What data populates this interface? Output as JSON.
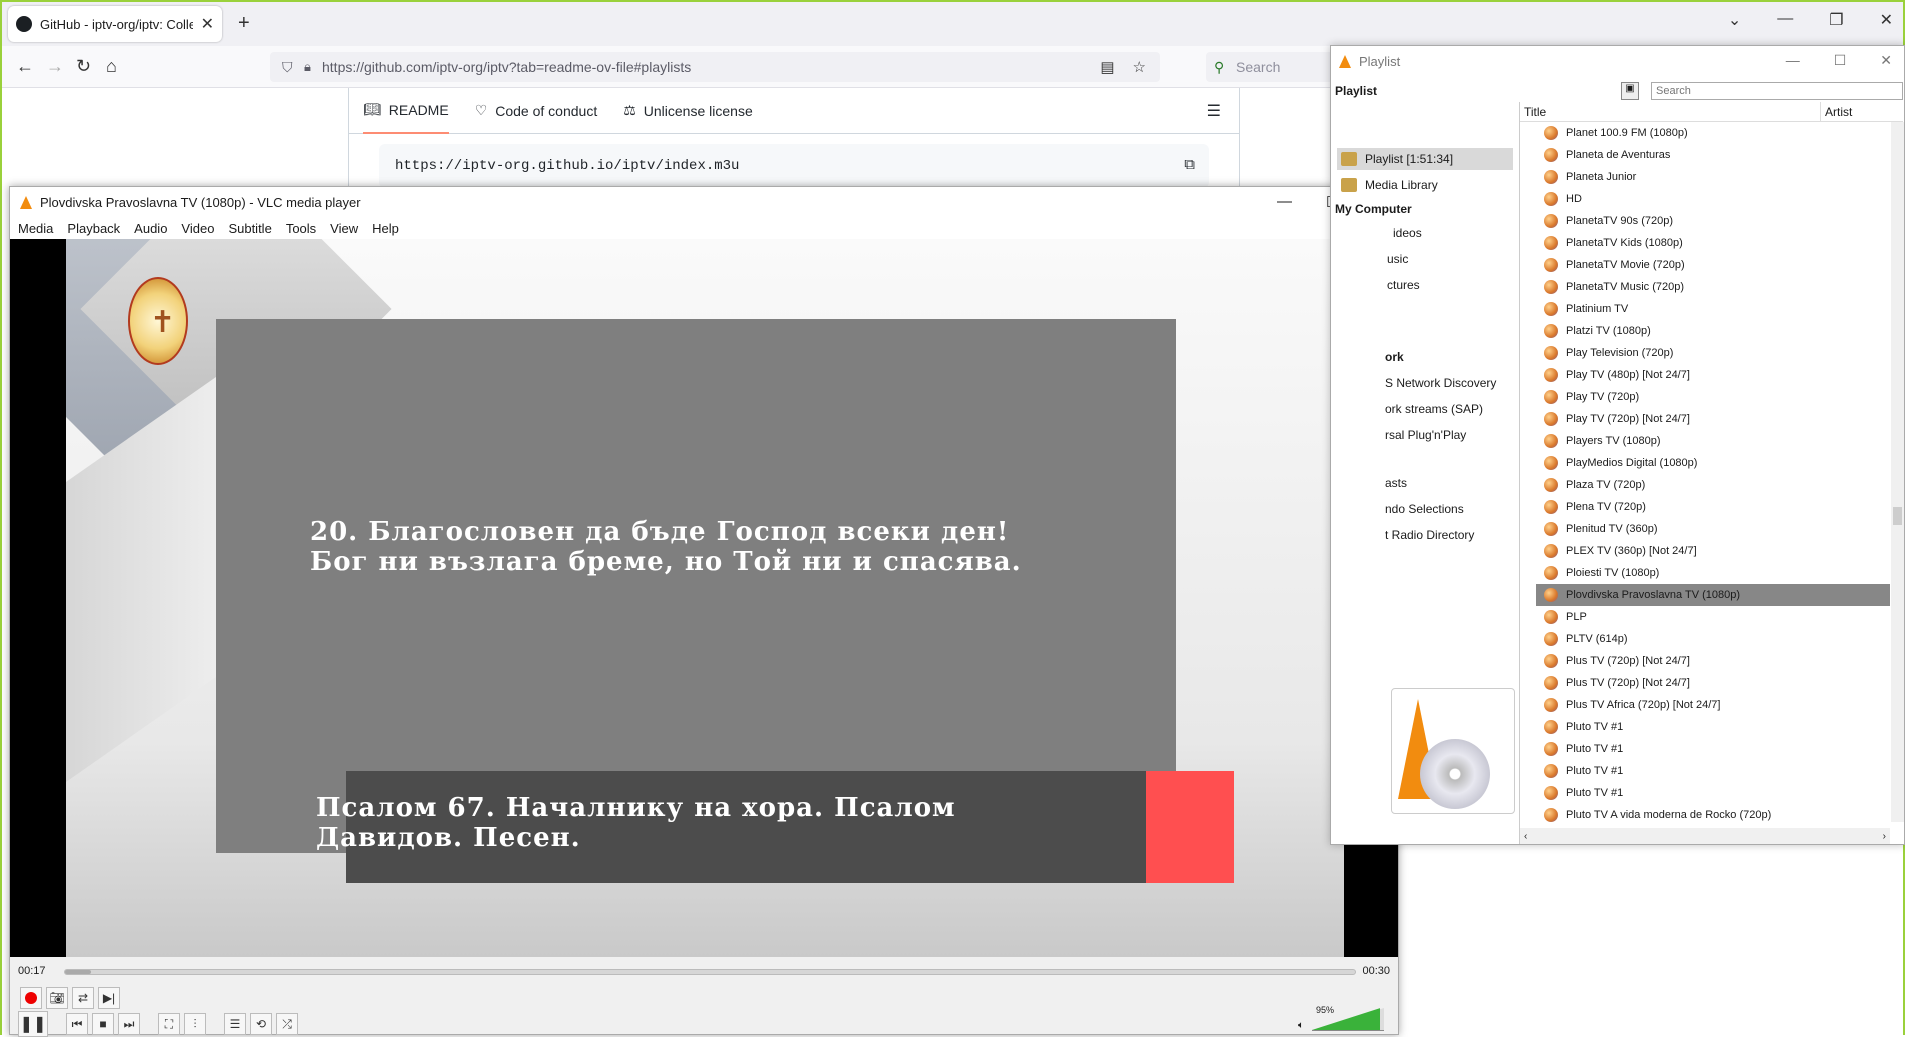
{
  "browser": {
    "tab_title": "GitHub - iptv-org/iptv: Collecti",
    "url": "https://github.com/iptv-org/iptv?tab=readme-ov-file#playlists",
    "search_placeholder": "Search"
  },
  "github": {
    "tabs": [
      {
        "label": "README"
      },
      {
        "label": "Code of conduct"
      },
      {
        "label": "Unlicense license"
      }
    ],
    "code": "https://iptv-org.github.io/iptv/index.m3u"
  },
  "vlc": {
    "title": "Plovdivska Pravoslavna TV (1080p) - VLC media player",
    "menu": [
      "Media",
      "Playback",
      "Audio",
      "Video",
      "Subtitle",
      "Tools",
      "View",
      "Help"
    ],
    "video": {
      "verse": "20. Благословен да бъде Господ всеки ден! Бог ни възлага бреме, но Той ни и спасява.",
      "psalm": "Псалом 67. Началнику на хора. Псалом Давидов. Песен."
    },
    "elapsed": "00:17",
    "total": "00:30",
    "progress": 0.02,
    "volume_label": "95%",
    "volume": 0.95
  },
  "playlist": {
    "window_title": "Playlist",
    "header": "Playlist",
    "search_placeholder": "Search",
    "sidebar": {
      "playlist_item": "Playlist [1:51:34]",
      "media_library": "Media Library",
      "my_computer": "My Computer",
      "cut_labels": [
        "ideos",
        "usic",
        "ctures",
        "ork",
        "S Network Discovery",
        "ork streams (SAP)",
        "rsal Plug'n'Play",
        "asts",
        "ndo Selections",
        "t Radio Directory"
      ]
    },
    "columns": {
      "title": "Title",
      "artist": "Artist"
    },
    "items": [
      "Planet 100.9 FM (1080p)",
      "Planeta de Aventuras",
      "Planeta Junior",
      "HD",
      "PlanetaTV 90s (720p)",
      "PlanetaTV Kids (1080p)",
      "PlanetaTV Movie (720p)",
      "PlanetaTV Music (720p)",
      "Platinium TV",
      "Platzi TV (1080p)",
      "Play Television (720p)",
      "Play TV (480p) [Not 24/7]",
      "Play TV (720p)",
      "Play TV (720p) [Not 24/7]",
      "Players TV (1080p)",
      "PlayMedios Digital (1080p)",
      "Plaza TV (720p)",
      "Plena TV (720p)",
      "Plenitud TV (360p)",
      "PLEX TV (360p) [Not 24/7]",
      "Ploiesti TV (1080p)",
      "Plovdivska Pravoslavna TV (1080p)",
      "PLP",
      "PLTV (614p)",
      "Plus TV (720p) [Not 24/7]",
      "Plus TV (720p) [Not 24/7]",
      "Plus TV Africa (720p) [Not 24/7]",
      "Pluto TV #1",
      "Pluto TV #1",
      "Pluto TV #1",
      "Pluto TV #1",
      "Pluto TV A vida moderna de Rocko (720p)"
    ],
    "selected_index": 21
  }
}
